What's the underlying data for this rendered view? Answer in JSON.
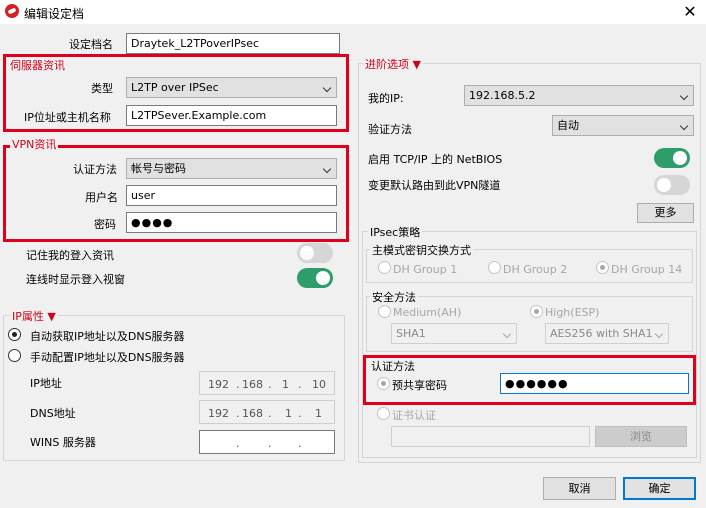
{
  "window": {
    "title": "编辑设定档",
    "close_glyph": "✕"
  },
  "profile": {
    "label": "设定档名",
    "value": "Draytek_L2TPoverIPsec"
  },
  "server": {
    "legend": "伺服器资讯",
    "type_label": "类型",
    "type_value": "L2TP over IPSec",
    "host_label": "IP位址或主机名称",
    "host_value": "L2TPSever.Example.com"
  },
  "vpn": {
    "legend": "VPN资讯",
    "auth_label": "认证方法",
    "auth_value": "帐号与密码",
    "user_label": "用户名",
    "user_value": "user",
    "pass_label": "密码",
    "pass_value": "●●●●"
  },
  "remember": {
    "label": "记住我的登入资讯",
    "state": "off"
  },
  "show_login": {
    "label": "连线时显示登入视窗",
    "state": "on"
  },
  "ip_props": {
    "legend": "IP属性 ▼",
    "auto_label": "自动获取IP地址以及DNS服务器",
    "manual_label": "手动配置IP地址以及DNS服务器",
    "ip_label": "IP地址",
    "ip_value": [
      "192",
      ".",
      "168",
      ".",
      "1",
      ".",
      "10"
    ],
    "dns_label": "DNS地址",
    "dns_value": [
      "192",
      ".",
      "168",
      ".",
      "1",
      ".",
      "1"
    ],
    "wins_label": "WINS 服务器",
    "wins_value": [
      ".",
      ".",
      "."
    ]
  },
  "advanced": {
    "legend": "进阶选项 ▼",
    "myip_label": "我的IP:",
    "myip_value": "192.168.5.2",
    "verify_label": "验证方法",
    "verify_value": "自动",
    "netbios_label": "启用 TCP/IP 上的 NetBIOS",
    "netbios_state": "on",
    "default_route_label": "变更默认路由到此VPN隧道",
    "default_route_state": "off",
    "more_label": "更多"
  },
  "ipsec": {
    "legend": "IPsec策略",
    "main_mode_legend": "主模式密钥交换方式",
    "dh1": "DH Group 1",
    "dh2": "DH Group 2",
    "dh14": "DH Group 14",
    "security_legend": "安全方法",
    "medium": "Medium(AH)",
    "high": "High(ESP)",
    "medium_select": "SHA1",
    "high_select": "AES256 with SHA1",
    "auth_legend": "认证方法",
    "psk_label": "预共享密码",
    "psk_value": "●●●●●●",
    "cert_label": "证书认证",
    "browse_label": "浏览"
  },
  "footer": {
    "cancel_label": "取消",
    "ok_label": "确定"
  },
  "colors": {
    "highlight_red": "#e0001b",
    "toggle_on": "#2d9d6a",
    "accent": "#0078d7"
  }
}
